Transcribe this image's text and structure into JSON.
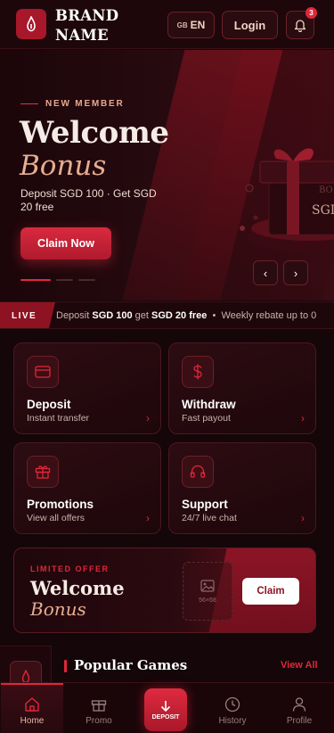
{
  "header": {
    "brand_line1": "BRAND",
    "brand_line2": "NAME",
    "lang_flag": "GB",
    "lang_code": "EN",
    "login_label": "Login",
    "notification_count": "3"
  },
  "hero": {
    "eyebrow": "NEW MEMBER",
    "title": "Welcome",
    "title_accent": "Bonus",
    "description": "Deposit SGD 100 · Get SGD 20 free",
    "cta_label": "Claim Now",
    "slide_count": 3,
    "active_slide": 1,
    "prev_label": "‹",
    "next_label": "›"
  },
  "ticker": {
    "tag": "LIVE",
    "parts": [
      "Deposit ",
      "SGD 100",
      " get ",
      "SGD 20 free",
      "  •  Weekly rebate up to 0"
    ]
  },
  "actions": [
    {
      "title": "Deposit",
      "subtitle": "Instant transfer",
      "icon": "card-icon"
    },
    {
      "title": "Withdraw",
      "subtitle": "Fast payout",
      "icon": "dollar-icon"
    },
    {
      "title": "Promotions",
      "subtitle": "View all offers",
      "icon": "gift-icon"
    },
    {
      "title": "Support",
      "subtitle": "24/7 live chat",
      "icon": "headset-icon"
    }
  ],
  "offer": {
    "eyebrow": "LIMITED OFFER",
    "title": "Welcome",
    "title_accent": "Bonus",
    "placeholder_label": "56×68",
    "cta_label": "Claim"
  },
  "games": {
    "title": "Popular Games",
    "view_all": "View All"
  },
  "bottom_nav": {
    "home": "Home",
    "promo": "Promo",
    "deposit": "DEPOSIT",
    "history": "History",
    "profile": "Profile"
  },
  "colors": {
    "accent": "#e2263a",
    "background": "#140609",
    "gold": "#e7ae92"
  }
}
